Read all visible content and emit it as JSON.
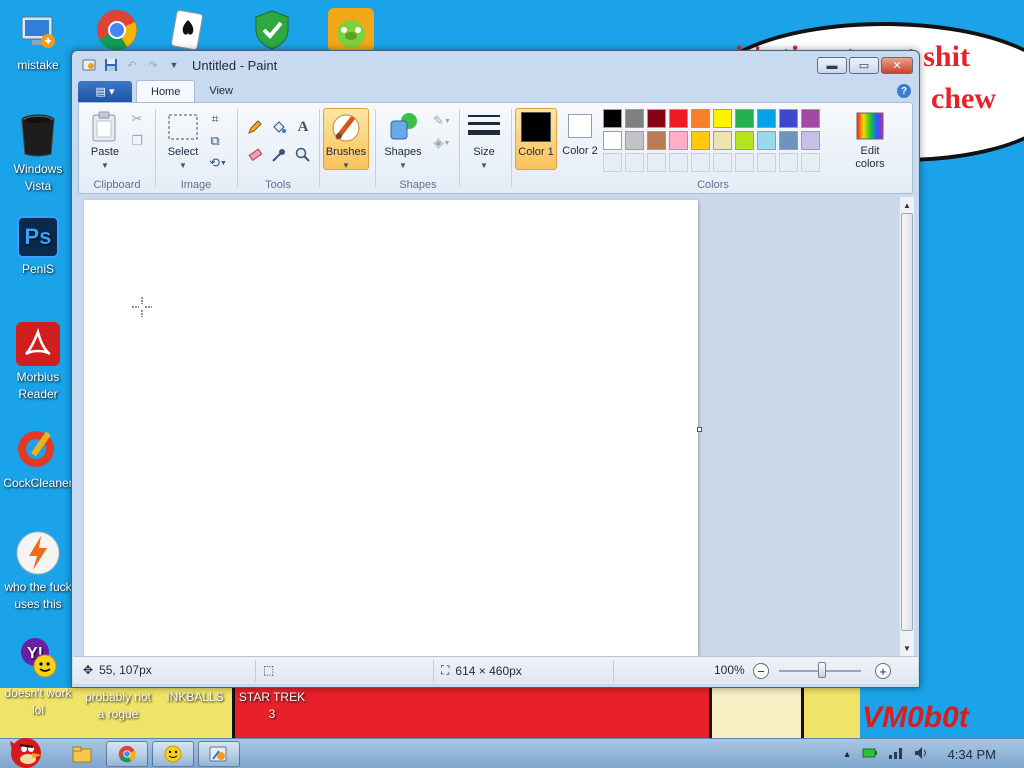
{
  "desktop": {
    "icons": [
      {
        "label": "mistake",
        "icon": "computer-icon"
      },
      {
        "label": "Windows Vista",
        "icon": "trash-bin-icon"
      },
      {
        "label": "PeniS",
        "icon": "photoshop-icon"
      },
      {
        "label": "Morbius Reader",
        "icon": "pdf-reader-icon"
      },
      {
        "label": "CockCleaner",
        "icon": "ccleaner-icon"
      },
      {
        "label": "who the fuck uses this",
        "icon": "winamp-icon"
      },
      {
        "label": "doesn't work lol",
        "icon": "yahoo-messenger-icon"
      }
    ],
    "top_icons": [
      "chrome-icon",
      "solitaire-icon",
      "security-shield-icon",
      "bad-piggies-icon"
    ],
    "wallpaper_labels": {
      "rogue": "probably not a rogue",
      "inkballs": "INKBALLS",
      "startrek": "STAR TREK 3"
    },
    "speech_bubble": {
      "line1": "it's time to eat shit",
      "line2": "chew"
    },
    "watermark": "VM0b0t"
  },
  "window": {
    "title": "Untitled - Paint",
    "tabs": {
      "menu": "▤ ▾",
      "home": "Home",
      "view": "View"
    },
    "ribbon": {
      "clipboard": {
        "paste": "Paste",
        "group": "Clipboard"
      },
      "image": {
        "select": "Select",
        "group": "Image"
      },
      "tools": {
        "group": "Tools"
      },
      "brushes": {
        "label": "Brushes"
      },
      "shapes": {
        "label": "Shapes",
        "group": "Shapes"
      },
      "size": {
        "label": "Size"
      },
      "colors": {
        "color1": "Color 1",
        "color2": "Color 2",
        "edit": "Edit colors",
        "group": "Colors",
        "color1_value": "#000000",
        "color2_value": "#ffffff",
        "palette_row1": [
          "#000000",
          "#7f7f7f",
          "#880015",
          "#ed1c24",
          "#ff7f27",
          "#fff200",
          "#22b14c",
          "#00a2e8",
          "#3f48cc",
          "#a349a4"
        ],
        "palette_row2": [
          "#ffffff",
          "#c3c3c3",
          "#b97a57",
          "#ffaec9",
          "#ffc90e",
          "#efe4b0",
          "#b5e61d",
          "#99d9ea",
          "#7092be",
          "#c8bfe7"
        ]
      }
    },
    "status": {
      "cursor_pos": "55, 107px",
      "canvas_size": "614 × 460px",
      "zoom": "100%",
      "zoom_minus": "−",
      "zoom_plus": "+"
    }
  },
  "taskbar": {
    "clock": "4:34 PM",
    "items": [
      "explorer-icon",
      "chrome-icon",
      "yahoo-messenger-icon",
      "paint-icon"
    ]
  }
}
